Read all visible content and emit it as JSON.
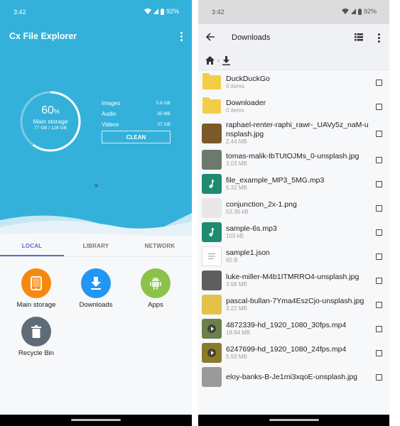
{
  "status_bar": {
    "time": "3:42",
    "battery": "92%"
  },
  "left_screen": {
    "app_title": "Cx File Explorer",
    "storage": {
      "percent": "60",
      "percent_sign": "%",
      "used_fraction": 0.6,
      "label": "Main storage",
      "size": "77 GB / 128 GB"
    },
    "stats": [
      {
        "label": "Images",
        "value": "5.6 GB"
      },
      {
        "label": "Audio",
        "value": "35 MB"
      },
      {
        "label": "Videos",
        "value": "27 GB"
      }
    ],
    "clean_label": "CLEAN",
    "tabs": [
      {
        "label": "LOCAL",
        "active": true
      },
      {
        "label": "LIBRARY",
        "active": false
      },
      {
        "label": "NETWORK",
        "active": false
      }
    ],
    "shortcuts": [
      {
        "label": "Main storage",
        "icon": "tablet-icon",
        "color": "#f5890e"
      },
      {
        "label": "Downloads",
        "icon": "download-icon",
        "color": "#2196f3"
      },
      {
        "label": "Apps",
        "icon": "android-icon",
        "color": "#8bc34a"
      },
      {
        "label": "Recycle Bin",
        "icon": "trash-icon",
        "color": "#5f6b76"
      }
    ]
  },
  "right_screen": {
    "title": "Downloads",
    "breadcrumb": [
      {
        "icon": "home-icon"
      },
      {
        "icon": "download-icon"
      }
    ],
    "files": [
      {
        "name": "DuckDuckGo",
        "meta": "0 items",
        "type": "folder"
      },
      {
        "name": "Downloader",
        "meta": "0 items",
        "type": "folder"
      },
      {
        "name": "raphael-renter-raphi_rawr-_UAVy5z_naM-unsplash.jpg",
        "meta": "2.44 MB",
        "type": "image",
        "thumb_color": "#7a5a2a"
      },
      {
        "name": "tomas-malik-tbTUtOJMs_0-unsplash.jpg",
        "meta": "3.03 MB",
        "type": "image",
        "thumb_color": "#6b7a6a"
      },
      {
        "name": "file_example_MP3_5MG.mp3",
        "meta": "5.32 MB",
        "type": "audio"
      },
      {
        "name": "conjunction_2x-1.png",
        "meta": "53.36 kB",
        "type": "image",
        "thumb_color": "#e8e8e8"
      },
      {
        "name": "sample-6s.mp3",
        "meta": "103 kB",
        "type": "audio"
      },
      {
        "name": "sample1.json",
        "meta": "65 B",
        "type": "doc"
      },
      {
        "name": "luke-miller-M4b1ITMRRO4-unsplash.jpg",
        "meta": "3.98 MB",
        "type": "image",
        "thumb_color": "#5e5e5e"
      },
      {
        "name": "pascal-bullan-7Yma4EszCjo-unsplash.jpg",
        "meta": "3.22 MB",
        "type": "image",
        "thumb_color": "#e3c24a"
      },
      {
        "name": "4872339-hd_1920_1080_30fps.mp4",
        "meta": "18.94 MB",
        "type": "video",
        "thumb_color": "#6d7f4a"
      },
      {
        "name": "6247699-hd_1920_1080_24fps.mp4",
        "meta": "5.93 MB",
        "type": "video",
        "thumb_color": "#8a7a2a"
      },
      {
        "name": "eloy-banks-B-Je1mi3xqoE-unsplash.jpg",
        "meta": "",
        "type": "image",
        "thumb_color": "#9a9a9a"
      }
    ]
  }
}
